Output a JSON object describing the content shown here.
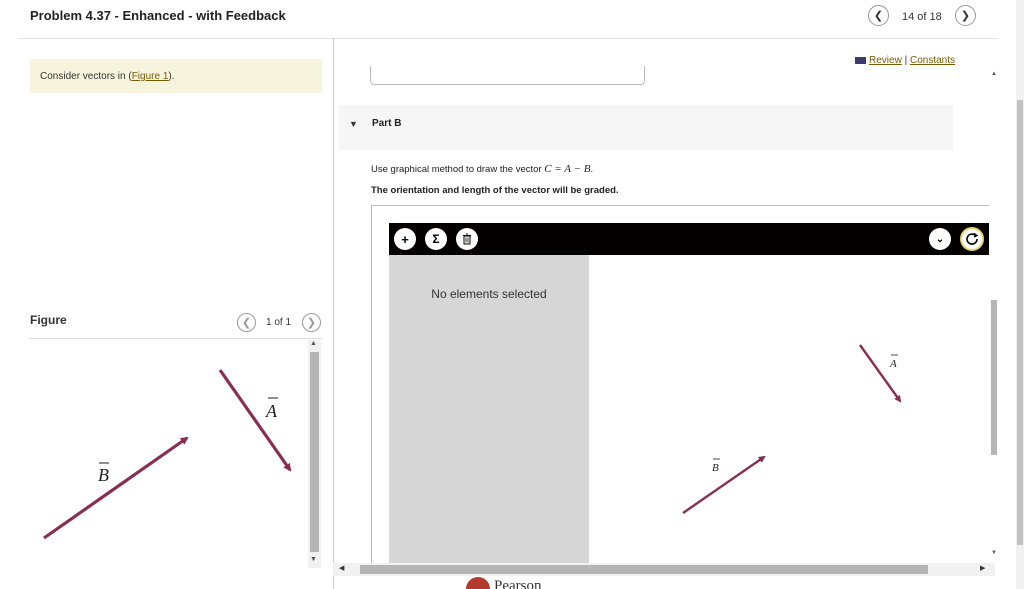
{
  "header": {
    "title": "Problem 4.37 - Enhanced - with Feedback",
    "prev_icon": "chevron-left-icon",
    "next_icon": "chevron-right-icon",
    "pager_text": "14 of 18"
  },
  "left_panel": {
    "consider_prefix": "Consider vectors in (",
    "figure_link": "Figure 1",
    "consider_suffix": ").",
    "figure_label": "Figure",
    "figure_pager": "1 of 1",
    "figure_vectors": {
      "a_label": "A",
      "b_label": "B"
    }
  },
  "right_panel": {
    "review_icon": "book-icon",
    "review_link": "Review",
    "separator": "|",
    "constants_link": "Constants",
    "part_label": "Part B",
    "instruction_prefix": "Use graphical method to draw the vector ",
    "instruction_equation": "C = A − B",
    "instruction_suffix": ".",
    "instruction_bold": "The orientation and length of the vector will be graded.",
    "tool": {
      "add_icon": "plus-icon",
      "sum_icon": "sigma-icon",
      "delete_icon": "trash-icon",
      "dropdown_icon": "chevron-down-icon",
      "reset_icon": "reset-icon",
      "empty_text": "No elements selected",
      "canvas_vectors": {
        "a_label": "A",
        "b_label": "B"
      }
    }
  },
  "footer": {
    "brand": "Pearson"
  },
  "colors": {
    "vector": "#8a2d52",
    "accent_link": "#7a5a00",
    "toolbar_bg": "#050000"
  }
}
